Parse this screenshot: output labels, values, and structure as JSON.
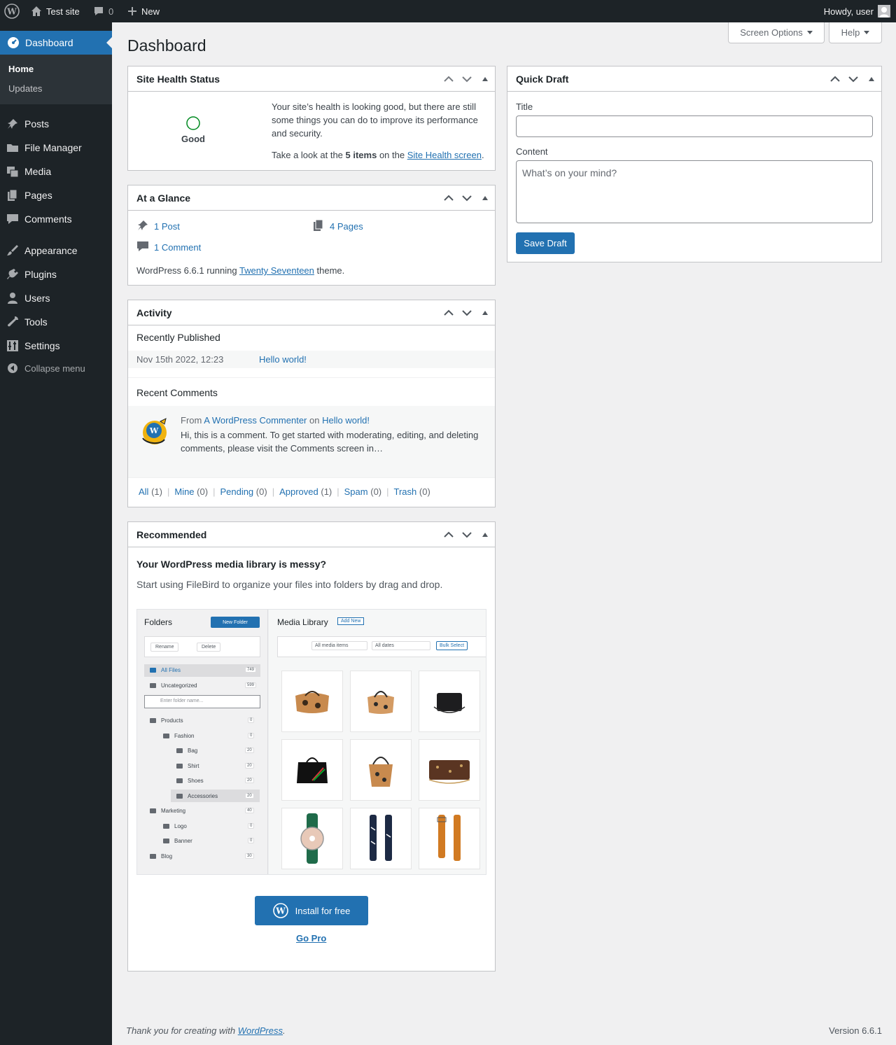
{
  "adminbar": {
    "site_name": "Test site",
    "comments_count": "0",
    "new_label": "New",
    "howdy": "Howdy, user"
  },
  "sidebar": {
    "dashboard": "Dashboard",
    "submenu": [
      "Home",
      "Updates"
    ],
    "items": [
      "Posts",
      "File Manager",
      "Media",
      "Pages",
      "Comments",
      "Appearance",
      "Plugins",
      "Users",
      "Tools",
      "Settings"
    ],
    "collapse": "Collapse menu"
  },
  "header": {
    "title": "Dashboard",
    "screen_options": "Screen Options",
    "help": "Help"
  },
  "site_health": {
    "title": "Site Health Status",
    "status": "Good",
    "message": "Your site’s health is looking good, but there are still some things you can do to improve its performance and security.",
    "look_prefix": "Take a look at the ",
    "items": "5 items",
    "look_mid": " on the ",
    "link": "Site Health screen",
    "look_suffix": "."
  },
  "glance": {
    "title": "At a Glance",
    "posts": "1 Post",
    "pages": "4 Pages",
    "comments": "1 Comment",
    "version_prefix": "WordPress 6.6.1 running ",
    "theme": "Twenty Seventeen",
    "version_suffix": " theme."
  },
  "activity": {
    "title": "Activity",
    "recently_published": "Recently Published",
    "pub_date": "Nov 15th 2022, 12:23",
    "pub_title": "Hello world!",
    "recent_comments": "Recent Comments",
    "from": "From",
    "author": "A WordPress Commenter",
    "on": "on",
    "post": "Hello world!",
    "comment_text": "Hi, this is a comment. To get started with moderating, editing, and deleting comments, please visit the Comments screen in…",
    "filters": [
      {
        "label": "All",
        "count": "(1)"
      },
      {
        "label": "Mine",
        "count": "(0)"
      },
      {
        "label": "Pending",
        "count": "(0)"
      },
      {
        "label": "Approved",
        "count": "(1)"
      },
      {
        "label": "Spam",
        "count": "(0)"
      },
      {
        "label": "Trash",
        "count": "(0)"
      }
    ]
  },
  "recommended": {
    "title": "Recommended",
    "heading": "Your WordPress media library is messy?",
    "subtext": "Start using FileBird to organize your files into folders by drag and drop.",
    "install": "Install for free",
    "go_pro": "Go Pro",
    "image": {
      "folders": "Folders",
      "new_folder": "New Folder",
      "rename": "Rename",
      "delete": "Delete",
      "all_files": "All Files",
      "all_files_count": "749",
      "uncategorized": "Uncategorized",
      "uncategorized_count": "599",
      "search_placeholder": "Enter folder name...",
      "tree": [
        {
          "name": "Products",
          "count": "0"
        },
        {
          "name": "Fashion",
          "count": "0"
        },
        {
          "name": "Bag",
          "count": "20"
        },
        {
          "name": "Shirt",
          "count": "20"
        },
        {
          "name": "Shoes",
          "count": "20"
        },
        {
          "name": "Accessories",
          "count": "20"
        },
        {
          "name": "Marketing",
          "count": "40"
        },
        {
          "name": "Logo",
          "count": "0"
        },
        {
          "name": "Banner",
          "count": "0"
        },
        {
          "name": "Blog",
          "count": "30"
        }
      ],
      "media_library": "Media Library",
      "add_new": "Add New",
      "all_media": "All media items",
      "all_dates": "All dates",
      "bulk_select": "Bulk Select"
    }
  },
  "quick_draft": {
    "title": "Quick Draft",
    "title_label": "Title",
    "content_label": "Content",
    "content_placeholder": "What’s on your mind?",
    "save": "Save Draft"
  },
  "footer": {
    "thanks_prefix": "Thank you for creating with ",
    "wordpress": "WordPress",
    "thanks_suffix": ".",
    "version": "Version 6.6.1"
  },
  "colors": {
    "accent": "#2271b1",
    "adminbar": "#1d2327",
    "health_good": "#008a20"
  }
}
